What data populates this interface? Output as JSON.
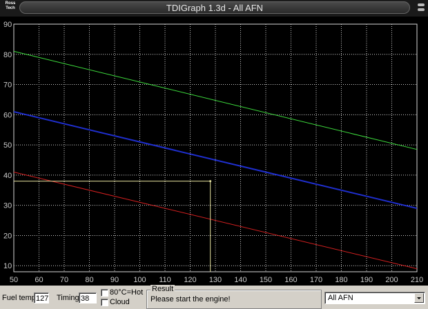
{
  "window": {
    "title": "TDIGraph 1.3d - All AFN",
    "logo_line1": "Ross",
    "logo_line2": "Tech"
  },
  "chart_data": {
    "type": "line",
    "title": "",
    "xlabel": "",
    "ylabel": "",
    "xlim": [
      50,
      210
    ],
    "ylim": [
      8,
      90
    ],
    "x_ticks": [
      50,
      60,
      70,
      80,
      90,
      100,
      110,
      120,
      130,
      140,
      150,
      160,
      170,
      180,
      190,
      200,
      210
    ],
    "y_ticks": [
      10,
      20,
      30,
      40,
      50,
      60,
      70,
      80,
      90
    ],
    "grid": true,
    "series": [
      {
        "color": "#3ddc3d",
        "x": [
          50,
          210
        ],
        "y": [
          81,
          48.5
        ]
      },
      {
        "color": "#1f2fd0",
        "x": [
          50,
          210
        ],
        "y": [
          61,
          29
        ]
      },
      {
        "color": "#d42020",
        "x": [
          50,
          210
        ],
        "y": [
          41,
          9
        ]
      }
    ],
    "cursor": {
      "x": 128,
      "y": 38,
      "color": "#e8e4a0"
    }
  },
  "status": {
    "fuel_temp_label": "Fuel temp",
    "fuel_temp_value": "127",
    "timing_label": "Timing",
    "timing_value": "38",
    "hot_checkbox_label": "80°C=Hot",
    "cloud_checkbox_label": "Cloud",
    "result_title": "Result",
    "result_text": "Please start the engine!",
    "engine_select": "All AFN"
  }
}
